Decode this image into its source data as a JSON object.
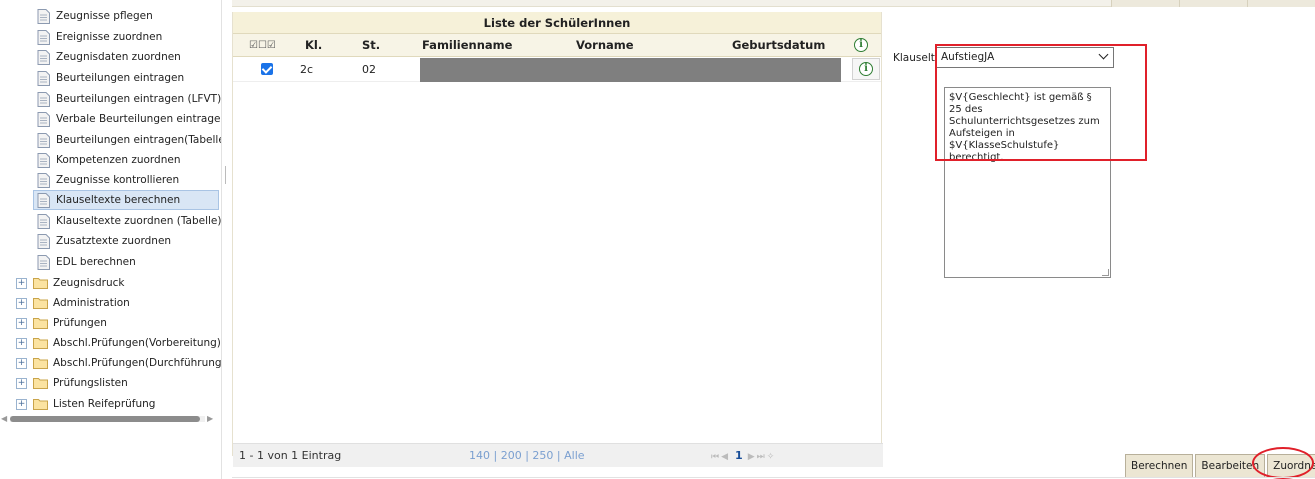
{
  "sidebar": {
    "items": [
      {
        "label": "Zeugnisse pflegen"
      },
      {
        "label": "Ereignisse zuordnen"
      },
      {
        "label": "Zeugnisdaten zuordnen"
      },
      {
        "label": "Beurteilungen eintragen"
      },
      {
        "label": "Beurteilungen eintragen (LFVT)"
      },
      {
        "label": "Verbale Beurteilungen eintragen"
      },
      {
        "label": "Beurteilungen eintragen(Tabelle)"
      },
      {
        "label": "Kompetenzen zuordnen"
      },
      {
        "label": "Zeugnisse kontrollieren"
      },
      {
        "label": "Klauseltexte berechnen"
      },
      {
        "label": "Klauseltexte zuordnen (Tabelle)"
      },
      {
        "label": "Zusatztexte zuordnen"
      },
      {
        "label": "EDL berechnen"
      }
    ],
    "folders": [
      {
        "label": "Zeugnisdruck"
      },
      {
        "label": "Administration"
      },
      {
        "label": "Prüfungen"
      },
      {
        "label": "Abschl.Prüfungen(Vorbereitung)"
      },
      {
        "label": "Abschl.Prüfungen(Durchführung)"
      },
      {
        "label": "Prüfungslisten"
      },
      {
        "label": "Listen Reifeprüfung"
      }
    ]
  },
  "grid": {
    "title": "Liste der SchülerInnen",
    "columns": {
      "checks": "☑☐☑",
      "klasse": "Kl.",
      "stufe": "St.",
      "familienname": "Familienname",
      "vorname": "Vorname",
      "geburtsdatum": "Geburtsdatum"
    },
    "rows": [
      {
        "selected": true,
        "klasse": "2c",
        "stufe": "02",
        "familienname": "",
        "vorname": "",
        "geburtsdatum": ""
      }
    ],
    "pager": {
      "count": "1 - 1 von 1 Eintrag",
      "size1": "140",
      "size2": "200",
      "size3": "250",
      "size_all": "Alle",
      "current_page": "1"
    }
  },
  "klausel": {
    "label": "Klauseltext",
    "selected": "AufstiegJA",
    "text": "$V{Geschlecht} ist gemäß § 25 des Schulunterrichtsgesetzes zum Aufsteigen in $V{KlasseSchulstufe} berechtigt."
  },
  "buttons": {
    "berechnen": "Berechnen",
    "bearbeiten": "Bearbeiten",
    "zuordnen": "Zuordnen"
  },
  "colors": {
    "highlight": "#e0202a",
    "grid_header": "#f6f1d9",
    "selection": "#d9e6f5"
  }
}
